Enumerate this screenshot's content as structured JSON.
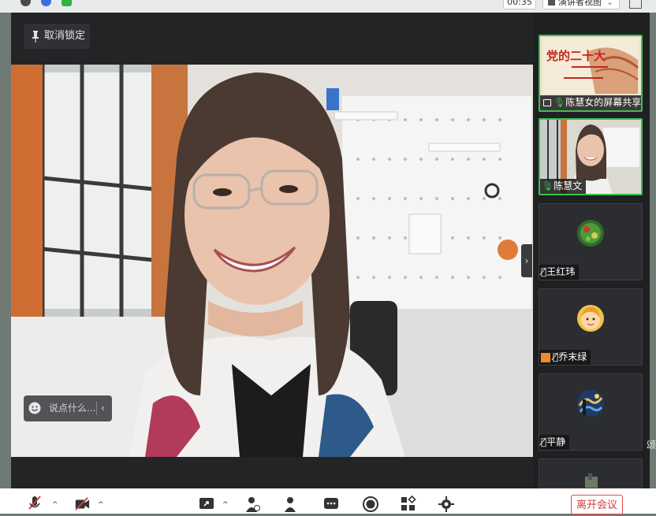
{
  "topbar": {
    "timer": "00:35",
    "view_label": "演讲者视图"
  },
  "main": {
    "unlock_label": "取消锁定",
    "chat_placeholder": "说点什么...",
    "speaker": "陈慧文"
  },
  "slide": {
    "title": "党的二十大"
  },
  "participants": [
    {
      "label": "陈慧女的屏幕共享",
      "type": "screen-share",
      "mic": "on"
    },
    {
      "label": "陈慧文",
      "type": "video",
      "mic": "on"
    },
    {
      "label": "王红玮",
      "type": "avatar",
      "mic": "muted"
    },
    {
      "label": "乔末绿",
      "type": "avatar",
      "mic": "muted"
    },
    {
      "label": "平静",
      "type": "avatar",
      "mic": "muted"
    },
    {
      "label": "",
      "type": "avatar",
      "mic": "muted"
    }
  ],
  "toolbar": {
    "leave_label": "离开会议"
  },
  "edge_char": "颂",
  "colors": {
    "active_border": "#39c14f",
    "leave_red": "#e24b4b",
    "panel_bg": "#232426"
  }
}
